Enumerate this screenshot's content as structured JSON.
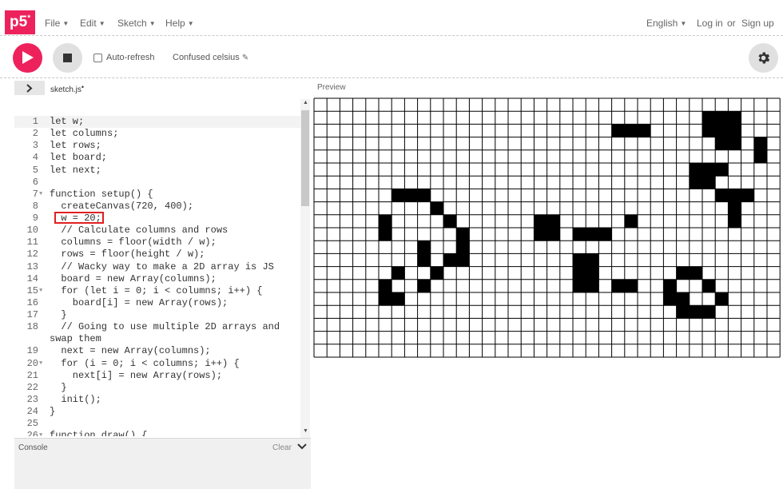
{
  "nav": {
    "logo": "p5",
    "logo_sup": "*",
    "menu": [
      "File",
      "Edit",
      "Sketch",
      "Help"
    ],
    "language": "English",
    "login": "Log in",
    "or": "or",
    "signup": "Sign up"
  },
  "toolbar": {
    "auto_refresh_label": "Auto-refresh",
    "auto_refresh_checked": false,
    "sketch_name": "Confused celsius",
    "edit_icon": "pencil-icon",
    "play_icon": "play-icon",
    "stop_icon": "stop-icon",
    "settings_icon": "gear-icon"
  },
  "editor": {
    "tab_name": "sketch.js",
    "tab_modified_marker": "•",
    "collapse_icon": "chevron-right-icon",
    "lines": [
      {
        "n": "1",
        "t": "let w;"
      },
      {
        "n": "2",
        "t": "let columns;"
      },
      {
        "n": "3",
        "t": "let rows;"
      },
      {
        "n": "4",
        "t": "let board;"
      },
      {
        "n": "5",
        "t": "let next;"
      },
      {
        "n": "6",
        "t": ""
      },
      {
        "n": "7",
        "t": "function setup() {",
        "fold": true
      },
      {
        "n": "8",
        "t": "  createCanvas(720, 400);"
      },
      {
        "n": "9",
        "t": "  w = 20;"
      },
      {
        "n": "10",
        "t": "  // Calculate columns and rows"
      },
      {
        "n": "11",
        "t": "  columns = floor(width / w);"
      },
      {
        "n": "12",
        "t": "  rows = floor(height / w);"
      },
      {
        "n": "13",
        "t": "  // Wacky way to make a 2D array is JS"
      },
      {
        "n": "14",
        "t": "  board = new Array(columns);"
      },
      {
        "n": "15",
        "t": "  for (let i = 0; i < columns; i++) {",
        "fold": true
      },
      {
        "n": "16",
        "t": "    board[i] = new Array(rows);"
      },
      {
        "n": "17",
        "t": "  }"
      },
      {
        "n": "18",
        "t": "  // Going to use multiple 2D arrays and"
      },
      {
        "n": "",
        "t": "swap them",
        "wrapped": true
      },
      {
        "n": "19",
        "t": "  next = new Array(columns);"
      },
      {
        "n": "20",
        "t": "  for (i = 0; i < columns; i++) {",
        "fold": true
      },
      {
        "n": "21",
        "t": "    next[i] = new Array(rows);"
      },
      {
        "n": "22",
        "t": "  }"
      },
      {
        "n": "23",
        "t": "  init();"
      },
      {
        "n": "24",
        "t": "}"
      },
      {
        "n": "25",
        "t": ""
      },
      {
        "n": "26",
        "t": "function draw() {",
        "fold": true
      }
    ],
    "highlighted_line": "9"
  },
  "preview": {
    "label": "Preview",
    "cols": 36,
    "rows": 20,
    "live_cells": [
      [
        23,
        2
      ],
      [
        24,
        2
      ],
      [
        25,
        2
      ],
      [
        30,
        1
      ],
      [
        31,
        1
      ],
      [
        32,
        1
      ],
      [
        30,
        2
      ],
      [
        31,
        2
      ],
      [
        32,
        2
      ],
      [
        31,
        3
      ],
      [
        32,
        3
      ],
      [
        34,
        3
      ],
      [
        34,
        4
      ],
      [
        29,
        5
      ],
      [
        30,
        5
      ],
      [
        31,
        5
      ],
      [
        29,
        6
      ],
      [
        30,
        6
      ],
      [
        31,
        7
      ],
      [
        32,
        7
      ],
      [
        33,
        7
      ],
      [
        32,
        8
      ],
      [
        32,
        9
      ],
      [
        6,
        7
      ],
      [
        7,
        7
      ],
      [
        8,
        7
      ],
      [
        9,
        8
      ],
      [
        5,
        9
      ],
      [
        10,
        9
      ],
      [
        5,
        10
      ],
      [
        22,
        10
      ],
      [
        11,
        10
      ],
      [
        17,
        9
      ],
      [
        18,
        9
      ],
      [
        17,
        10
      ],
      [
        18,
        10
      ],
      [
        21,
        10
      ],
      [
        24,
        9
      ],
      [
        11,
        11
      ],
      [
        8,
        11
      ],
      [
        8,
        12
      ],
      [
        10,
        12
      ],
      [
        11,
        12
      ],
      [
        20,
        10
      ],
      [
        21,
        10
      ],
      [
        6,
        13
      ],
      [
        9,
        13
      ],
      [
        20,
        12
      ],
      [
        20,
        13
      ],
      [
        21,
        12
      ],
      [
        21,
        13
      ],
      [
        8,
        14
      ],
      [
        21,
        14
      ],
      [
        23,
        14
      ],
      [
        24,
        14
      ],
      [
        28,
        13
      ],
      [
        29,
        13
      ],
      [
        27,
        14
      ],
      [
        30,
        14
      ],
      [
        5,
        15
      ],
      [
        6,
        15
      ],
      [
        27,
        15
      ],
      [
        28,
        15
      ],
      [
        31,
        15
      ],
      [
        28,
        16
      ],
      [
        29,
        16
      ],
      [
        30,
        16
      ],
      [
        20,
        14
      ],
      [
        5,
        14
      ]
    ]
  },
  "console": {
    "label": "Console",
    "clear": "Clear",
    "toggle_icon": "chevron-down-icon"
  },
  "colors": {
    "brand": "#ed225d",
    "grid_line": "#000000",
    "cell_alive": "#000000",
    "cell_dead": "#ffffff",
    "highlight_box": "#e02020",
    "keyword": "#333333",
    "function_name": "#0b7ca9",
    "comment": "#666666"
  }
}
